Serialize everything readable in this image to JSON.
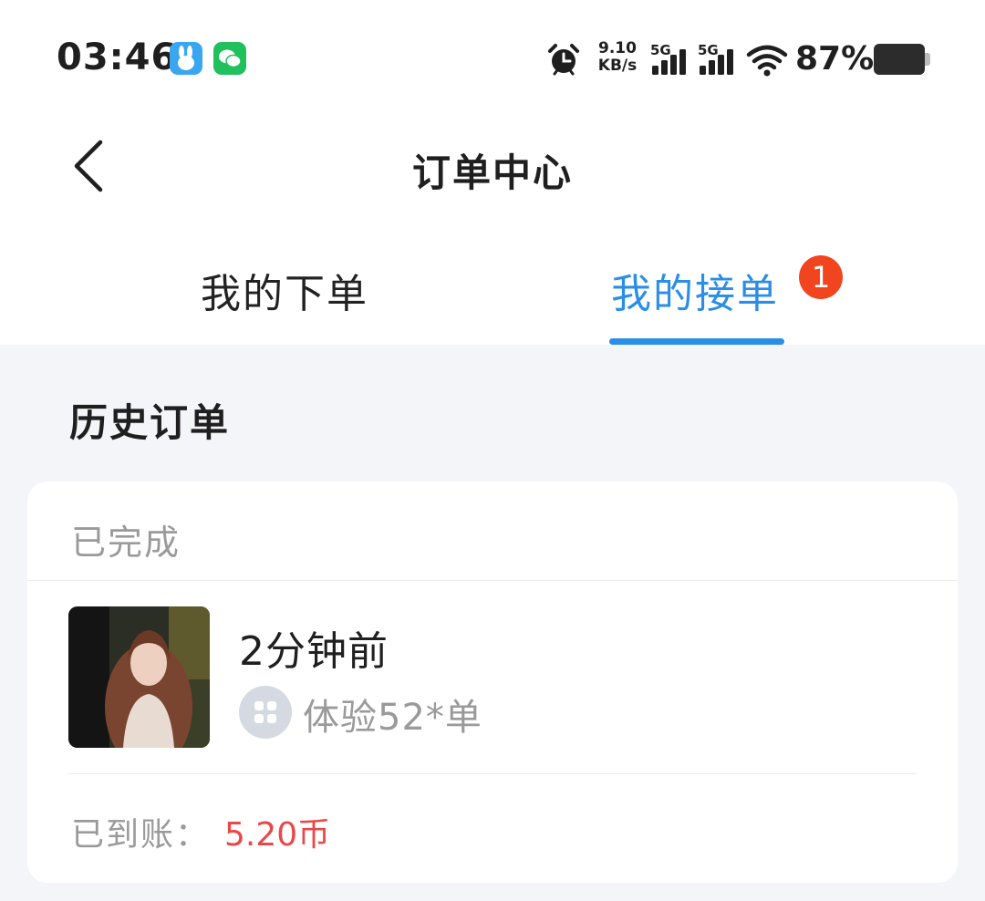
{
  "status_bar": {
    "time": "03:46",
    "net_speed_value": "9.10",
    "net_speed_unit": "KB/s",
    "signal_1_label": "5G",
    "signal_2_label": "5G",
    "battery_percent": "87%",
    "app_icons": [
      "bunny-app-icon",
      "wechat-icon"
    ]
  },
  "nav": {
    "title": "订单中心"
  },
  "tabs": [
    {
      "label": "我的下单",
      "active": false
    },
    {
      "label": "我的接单",
      "active": true,
      "badge": "1"
    }
  ],
  "colors": {
    "accent": "#2A8EE6",
    "badge": "#F1451F",
    "amount": "#E84848",
    "muted_text": "#9A9A9A",
    "background": "#F4F5F9"
  },
  "section": {
    "title": "历史订单"
  },
  "order_card": {
    "status": "已完成",
    "time_ago": "2分钟前",
    "service": "体验52*单",
    "paid_label": "已到账：",
    "paid_amount": "5.20币"
  }
}
